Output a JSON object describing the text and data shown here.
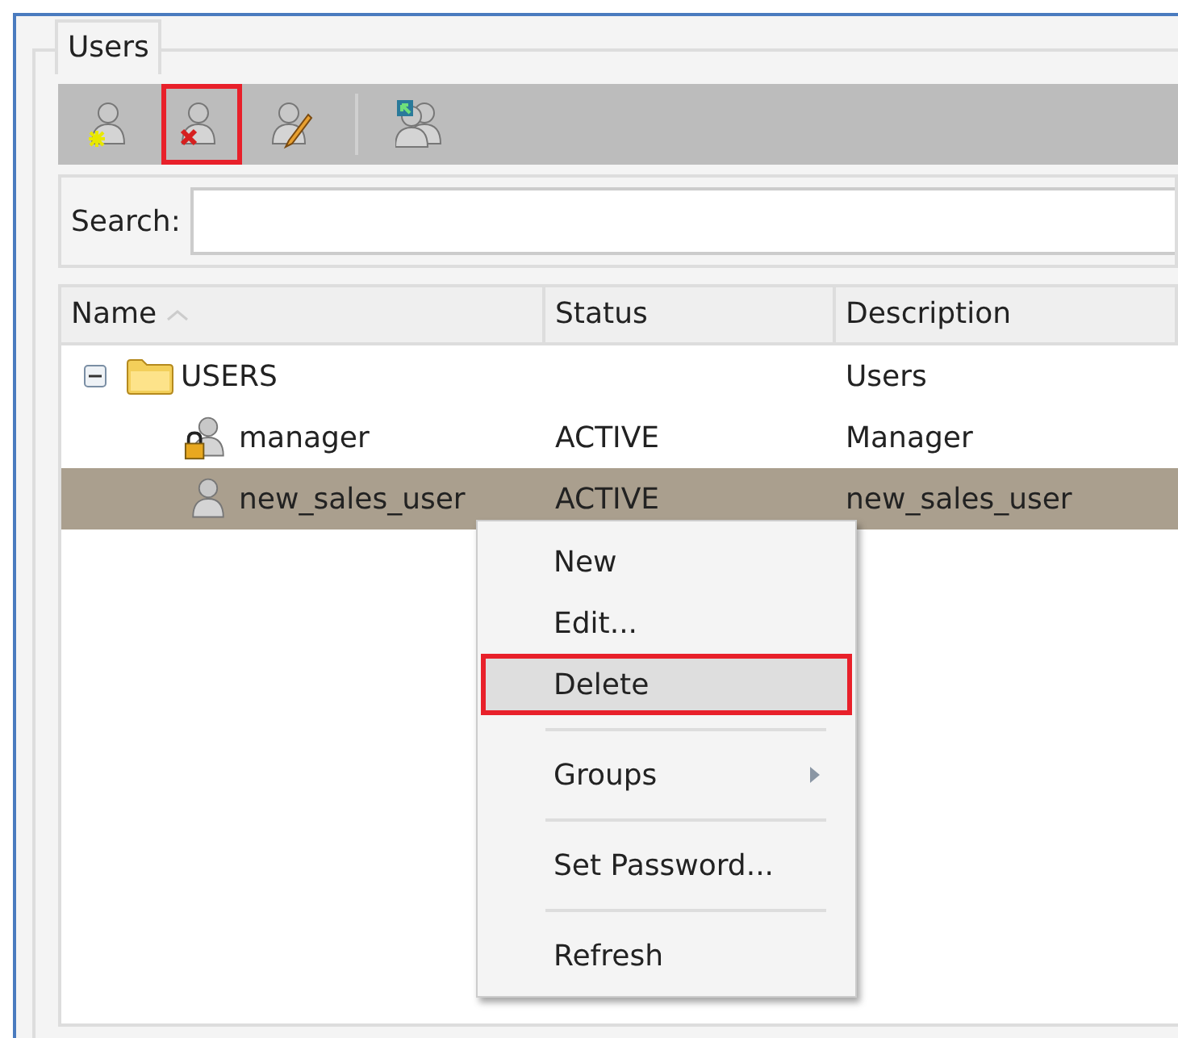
{
  "panel": {
    "title": "Users"
  },
  "toolbar": [
    {
      "kind": "add-user",
      "highlighted": false
    },
    {
      "kind": "delete-user",
      "highlighted": true
    },
    {
      "kind": "edit-user",
      "highlighted": false
    },
    {
      "kind": "separator"
    },
    {
      "kind": "user-groups",
      "highlighted": false
    }
  ],
  "search": {
    "label": "Search:"
  },
  "table": {
    "columns": [
      {
        "label": "Name",
        "sorted": true
      },
      {
        "label": "Status",
        "sorted": false
      },
      {
        "label": "Description",
        "sorted": false
      }
    ],
    "rows": [
      {
        "kind": "folder",
        "name": "USERS",
        "status": "",
        "description": "Users",
        "expanded": true,
        "selected": false,
        "children": [
          {
            "kind": "user",
            "name": "manager",
            "locked": true,
            "status": "ACTIVE",
            "description": "Manager",
            "selected": false
          },
          {
            "kind": "user",
            "name": "new_sales_user",
            "locked": false,
            "status": "ACTIVE",
            "description": "new_sales_user",
            "selected": true
          }
        ]
      }
    ]
  },
  "context_menu": [
    {
      "kind": "item",
      "label": "New",
      "highlighted": false
    },
    {
      "kind": "item",
      "label": "Edit...",
      "highlighted": false
    },
    {
      "kind": "item",
      "label": "Delete",
      "highlighted": true
    },
    {
      "kind": "separator"
    },
    {
      "kind": "item",
      "label": "Groups",
      "submenu": true,
      "highlighted": false
    },
    {
      "kind": "separator"
    },
    {
      "kind": "item",
      "label": "Set Password...",
      "highlighted": false
    },
    {
      "kind": "separator"
    },
    {
      "kind": "item",
      "label": "Refresh",
      "highlighted": false
    }
  ]
}
